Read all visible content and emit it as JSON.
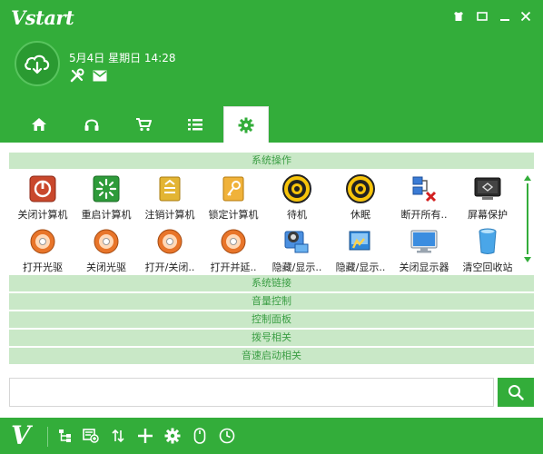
{
  "app": {
    "logo_text": "Vstart"
  },
  "window_controls": {
    "items": [
      {
        "name": "skin-icon"
      },
      {
        "name": "menu-icon"
      },
      {
        "name": "minimize-icon"
      },
      {
        "name": "close-icon"
      }
    ]
  },
  "user": {
    "datetime": "5月4日 星期日 14:28"
  },
  "quick_icons": [
    {
      "name": "tools-icon"
    },
    {
      "name": "mail-icon"
    }
  ],
  "tabs": [
    {
      "name": "home-icon",
      "active": false
    },
    {
      "name": "headphones-icon",
      "active": false
    },
    {
      "name": "cart-icon",
      "active": false
    },
    {
      "name": "list-icon",
      "active": false
    },
    {
      "name": "gear-icon",
      "active": true
    }
  ],
  "sections": {
    "system_ops": "系统操作",
    "system_links": "系统链接",
    "volume": "音量控制",
    "control_panel": "控制面板",
    "dialup": "拨号相关",
    "quick_launch": "音速启动相关"
  },
  "grid_items": [
    {
      "label": "关闭计算机",
      "icon": "power-off-icon"
    },
    {
      "label": "重启计算机",
      "icon": "restart-icon"
    },
    {
      "label": "注销计算机",
      "icon": "logoff-icon"
    },
    {
      "label": "锁定计算机",
      "icon": "lock-key-icon"
    },
    {
      "label": "待机",
      "icon": "standby-icon"
    },
    {
      "label": "休眠",
      "icon": "hibernate-icon"
    },
    {
      "label": "断开所有..",
      "icon": "network-disconnect-icon"
    },
    {
      "label": "屏幕保护",
      "icon": "screensaver-icon"
    },
    {
      "label": "打开光驱",
      "icon": "cd-open-icon"
    },
    {
      "label": "关闭光驱",
      "icon": "cd-close-icon"
    },
    {
      "label": "打开/关闭..",
      "icon": "cd-toggle-icon"
    },
    {
      "label": "打开并延..",
      "icon": "cd-delay-icon"
    },
    {
      "label": "隐藏/显示..",
      "icon": "hide-show-icon"
    },
    {
      "label": "隐藏/显示..",
      "icon": "hide-show-desktop-icon"
    },
    {
      "label": "关闭显示器",
      "icon": "monitor-off-icon"
    },
    {
      "label": "清空回收站",
      "icon": "recycle-bin-icon"
    }
  ],
  "search": {
    "value": "",
    "placeholder": ""
  },
  "footer": {
    "logo_text": "V",
    "icons": [
      {
        "name": "tree-icon"
      },
      {
        "name": "add-item-icon"
      },
      {
        "name": "sort-icon"
      },
      {
        "name": "plus-icon"
      },
      {
        "name": "settings-icon"
      },
      {
        "name": "mouse-icon"
      },
      {
        "name": "clock-icon"
      }
    ]
  },
  "colors": {
    "brand": "#33ad3a",
    "section_bg": "#c9e8c7",
    "section_text": "#3b9e44"
  }
}
